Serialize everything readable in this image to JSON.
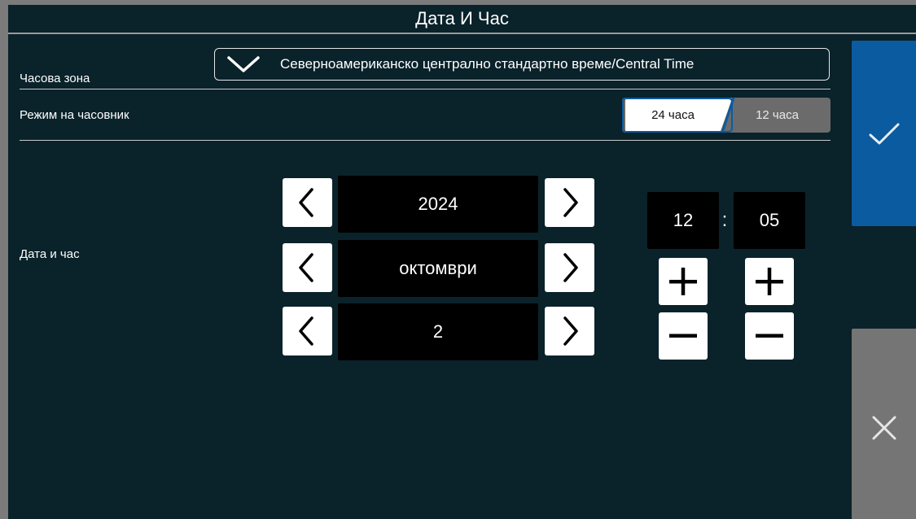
{
  "title": "Дата И Час",
  "timezone": {
    "label": "Часова зона",
    "value": "Северноамериканско централно стандартно време/Central Time"
  },
  "clock_mode": {
    "label": "Режим на часовник",
    "option_24": "24 часа",
    "option_12": "12 часа",
    "selected": "24 часа"
  },
  "datetime": {
    "label": "Дата и час",
    "year": "2024",
    "month": "октомври",
    "day": "2",
    "hour": "12",
    "colon": ":",
    "minute": "05"
  },
  "actions": {
    "confirm_icon": "check-icon",
    "cancel_icon": "close-icon"
  },
  "colors": {
    "background": "#0a222a",
    "confirm": "#0b5ba0",
    "cancel": "#757575",
    "frame": "#7b7b7b"
  }
}
